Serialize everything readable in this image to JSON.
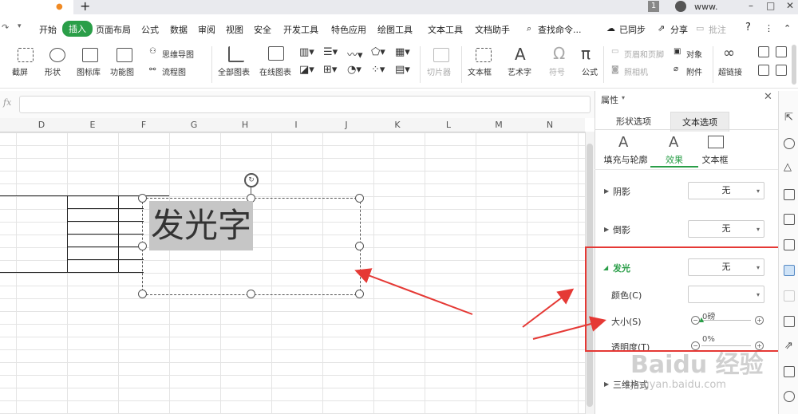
{
  "titlebar": {
    "new_tab": "+",
    "page_num": "1",
    "account": "www.",
    "win_min": "–",
    "win_max": "□",
    "win_close": "✕"
  },
  "menu": {
    "items": [
      "开始",
      "插入",
      "页面布局",
      "公式",
      "数据",
      "审阅",
      "视图",
      "安全",
      "开发工具",
      "特色应用",
      "绘图工具",
      "文本工具",
      "文档助手"
    ],
    "active": "插入",
    "search": "查找命令...",
    "sync": "已同步",
    "share": "分享",
    "comment": "批注",
    "help": "?"
  },
  "ribbon": {
    "big": [
      "截屏",
      "形状",
      "图标库",
      "功能图",
      "全部图表",
      "在线图表",
      "切片器",
      "文本框",
      "艺术字",
      "符号",
      "公式",
      "超链接"
    ],
    "mind_map": "思维导图",
    "flow_chart": "流程图",
    "header_footer": "页眉和页脚",
    "object": "对象",
    "camera": "照相机",
    "attachment": "附件"
  },
  "formula": {
    "fx": "fx",
    "value": ""
  },
  "columns": [
    "D",
    "E",
    "F",
    "G",
    "H",
    "I",
    "J",
    "K",
    "L",
    "M",
    "N"
  ],
  "textbox": {
    "text": "发光字"
  },
  "panel": {
    "title": "属性",
    "close": "✕",
    "tabs": [
      "形状选项",
      "文本选项"
    ],
    "active_tab": "文本选项",
    "subtabs": [
      "填充与轮廓",
      "效果",
      "文本框"
    ],
    "active_subtab": "效果",
    "shadow_label": "阴影",
    "shadow_value": "无",
    "reflection_label": "倒影",
    "reflection_value": "无",
    "glow_label": "发光",
    "glow_value": "无",
    "color_label": "颜色(C)",
    "size_label": "大小(S)",
    "size_value": "0磅",
    "transparency_label": "透明度(T)",
    "transparency_value": "0%",
    "format3d_label": "三维格式"
  },
  "watermark": {
    "logo": "Baidu 经验",
    "url": "jingyan.baidu.com"
  },
  "colors": {
    "accent": "#2a9e48",
    "highlight": "#e53935",
    "glow_bg": "#c6c6c6"
  }
}
